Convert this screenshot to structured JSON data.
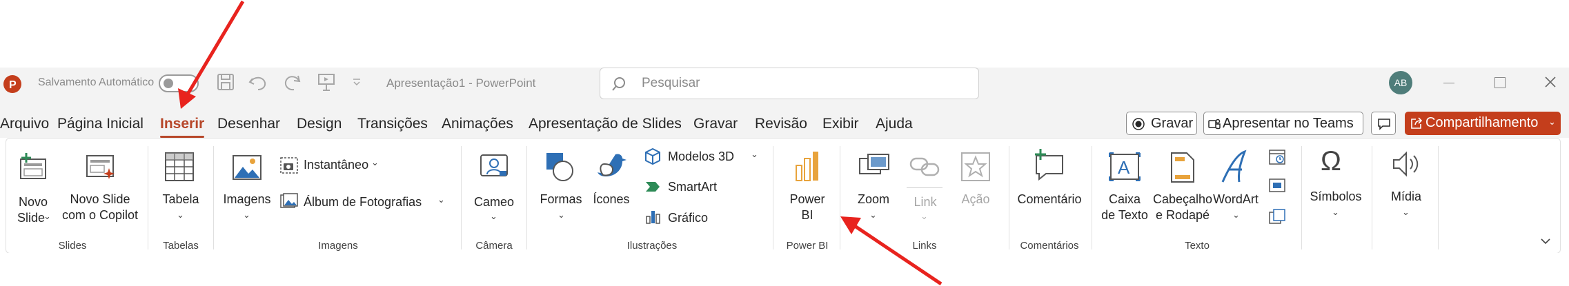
{
  "titlebar": {
    "autosave_label": "Salvamento Automático",
    "doc_title": "Apresentação1  -  PowerPoint",
    "search_placeholder": "Pesquisar",
    "avatar_initials": "AB"
  },
  "tabs": [
    "Arquivo",
    "Página Inicial",
    "Inserir",
    "Desenhar",
    "Design",
    "Transições",
    "Animações",
    "Apresentação de Slides",
    "Gravar",
    "Revisão",
    "Exibir",
    "Ajuda"
  ],
  "active_tab": "Inserir",
  "right_buttons": {
    "record": "Gravar",
    "teams": "Apresentar no Teams",
    "share": "Compartilhamento"
  },
  "ribbon": {
    "slides": {
      "novo_slide_l1": "Novo",
      "novo_slide_l2": "Slide",
      "copilot_l1": "Novo Slide",
      "copilot_l2": "com o Copilot",
      "group": "Slides"
    },
    "tables": {
      "table": "Tabela",
      "group": "Tabelas"
    },
    "images": {
      "images": "Imagens",
      "snapshot": "Instantâneo",
      "album": "Álbum de Fotografias",
      "group": "Imagens"
    },
    "camera": {
      "cameo": "Cameo",
      "group": "Câmera"
    },
    "illustrations": {
      "shapes": "Formas",
      "icons": "Ícones",
      "models3d": "Modelos 3D",
      "smartart": "SmartArt",
      "chart": "Gráfico",
      "group": "Ilustrações"
    },
    "powerbi": {
      "l1": "Power",
      "l2": "BI",
      "group": "Power BI"
    },
    "links": {
      "zoom": "Zoom",
      "link": "Link",
      "action": "Ação",
      "group": "Links"
    },
    "comments": {
      "comment": "Comentário",
      "group": "Comentários"
    },
    "text": {
      "textbox_l1": "Caixa",
      "textbox_l2": "de Texto",
      "header_l1": "Cabeçalho",
      "header_l2": "e Rodapé",
      "wordart": "WordArt",
      "group": "Texto"
    },
    "symbols": {
      "symbols": "Símbolos"
    },
    "media": {
      "media": "Mídia"
    }
  },
  "colors": {
    "accent": "#b7472a",
    "share_bg": "#c43e1c",
    "annotation_arrow": "#e8231e"
  }
}
